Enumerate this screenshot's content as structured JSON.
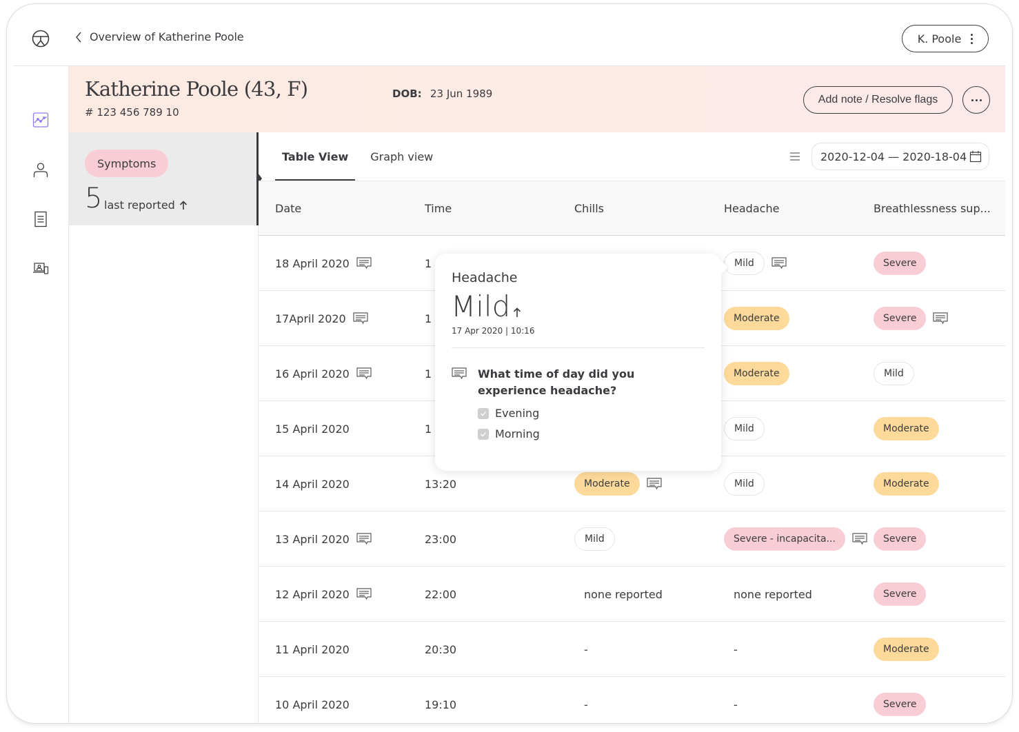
{
  "header": {
    "back_label": "Overview of Katherine Poole",
    "user_button_label": "K. Poole"
  },
  "sidebar": {
    "items": [
      {
        "name": "trends",
        "icon": "chart-icon",
        "active": true
      },
      {
        "name": "profile",
        "icon": "person-icon",
        "active": false
      },
      {
        "name": "documents",
        "icon": "document-icon",
        "active": false
      },
      {
        "name": "devices",
        "icon": "devices-icon",
        "active": false
      }
    ]
  },
  "patient": {
    "name": "Katherine Poole (43,  F)",
    "id": "# 123 456 789 10",
    "dob_label": "DOB:",
    "dob": "23 Jun 1989",
    "add_note_label": "Add note / Resolve flags"
  },
  "category": {
    "label": "Symptoms",
    "count": "5",
    "count_label": "last reported"
  },
  "tabs": [
    {
      "label": "Table View",
      "active": true
    },
    {
      "label": "Graph view",
      "active": false
    }
  ],
  "date_range": "2020-12-04 — 2020-18-04",
  "table": {
    "columns": [
      "Date",
      "Time",
      "Chills",
      "Headache",
      "Breathlessness sup..."
    ],
    "rows": [
      {
        "date": "18 April 2020",
        "date_note": true,
        "time": "1",
        "chills": null,
        "headache": {
          "value": "Mild",
          "level": "mild",
          "note": true
        },
        "breath": {
          "value": "Severe",
          "level": "severe",
          "note": false
        }
      },
      {
        "date": "17April 2020",
        "date_note": true,
        "time": "1",
        "chills": null,
        "headache": {
          "value": "Moderate",
          "level": "moderate",
          "note": false
        },
        "breath": {
          "value": "Severe",
          "level": "severe",
          "note": true
        }
      },
      {
        "date": "16 April 2020",
        "date_note": true,
        "time": "1",
        "chills": null,
        "headache": {
          "value": "Moderate",
          "level": "moderate",
          "note": false
        },
        "breath": {
          "value": "Mild",
          "level": "mild",
          "note": false
        }
      },
      {
        "date": "15 April 2020",
        "date_note": false,
        "time": "1",
        "chills": null,
        "headache": {
          "value": "Mild",
          "level": "mild",
          "note": false
        },
        "breath": {
          "value": "Moderate",
          "level": "moderate",
          "note": false
        }
      },
      {
        "date": "14 April 2020",
        "date_note": false,
        "time": "13:20",
        "chills": {
          "value": "Moderate",
          "level": "moderate",
          "note": true
        },
        "headache": {
          "value": "Mild",
          "level": "mild",
          "note": false
        },
        "breath": {
          "value": "Moderate",
          "level": "moderate",
          "note": false
        }
      },
      {
        "date": "13 April 2020",
        "date_note": true,
        "time": "23:00",
        "chills": {
          "value": "Mild",
          "level": "mild",
          "note": false
        },
        "headache": {
          "value": "Severe - incapacita...",
          "level": "severe",
          "note": true
        },
        "breath": {
          "value": "Severe",
          "level": "severe",
          "note": false
        }
      },
      {
        "date": "12 April 2020",
        "date_note": true,
        "time": "22:00",
        "chills": {
          "value": "none reported",
          "level": "plain",
          "note": false
        },
        "headache": {
          "value": "none reported",
          "level": "plain",
          "note": false
        },
        "breath": {
          "value": "Severe",
          "level": "severe",
          "note": false
        }
      },
      {
        "date": "11 April 2020",
        "date_note": false,
        "time": "20:30",
        "chills": {
          "value": "-",
          "level": "plain",
          "note": false
        },
        "headache": {
          "value": "-",
          "level": "plain",
          "note": false
        },
        "breath": {
          "value": "Moderate",
          "level": "moderate",
          "note": false
        }
      },
      {
        "date": "10 April 2020",
        "date_note": false,
        "time": "19:10",
        "chills": {
          "value": "-",
          "level": "plain",
          "note": false
        },
        "headache": {
          "value": "-",
          "level": "plain",
          "note": false
        },
        "breath": {
          "value": "Severe",
          "level": "severe",
          "note": false
        }
      }
    ]
  },
  "popover": {
    "title": "Headache",
    "value": "Mild",
    "timestamp": "17 Apr 2020 | 10:16",
    "question": "What time of day did you experience headache?",
    "options": [
      {
        "label": "Evening",
        "checked": true
      },
      {
        "label": "Morning",
        "checked": true
      }
    ]
  },
  "colors": {
    "accent": "#8b7cf6",
    "mild": "#ffffff",
    "moderate": "#fdd99a",
    "severe": "#f9cdd6",
    "banner": "#fdeae1",
    "text": "#3b3b3f"
  }
}
